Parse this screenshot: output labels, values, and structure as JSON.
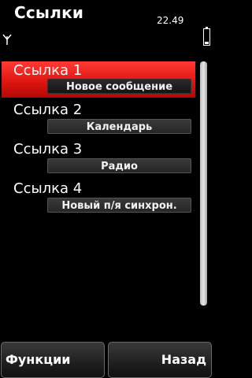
{
  "status": {
    "title": "Ссылки",
    "time": "22.49",
    "icons": {
      "signal": "signal-antenna-icon",
      "battery": "battery-icon"
    }
  },
  "list": {
    "items": [
      {
        "label": "Ссылка 1",
        "value": "Новое сообщение",
        "selected": true
      },
      {
        "label": "Ссылка 2",
        "value": "Календарь",
        "selected": false
      },
      {
        "label": "Ссылка 3",
        "value": "Радио",
        "selected": false
      },
      {
        "label": "Ссылка 4",
        "value": "Новый п/я синхрон.",
        "selected": false
      }
    ]
  },
  "softkeys": {
    "left": "Функции",
    "right": "Назад"
  },
  "colors": {
    "accent": "#e01612",
    "background": "#000000"
  }
}
